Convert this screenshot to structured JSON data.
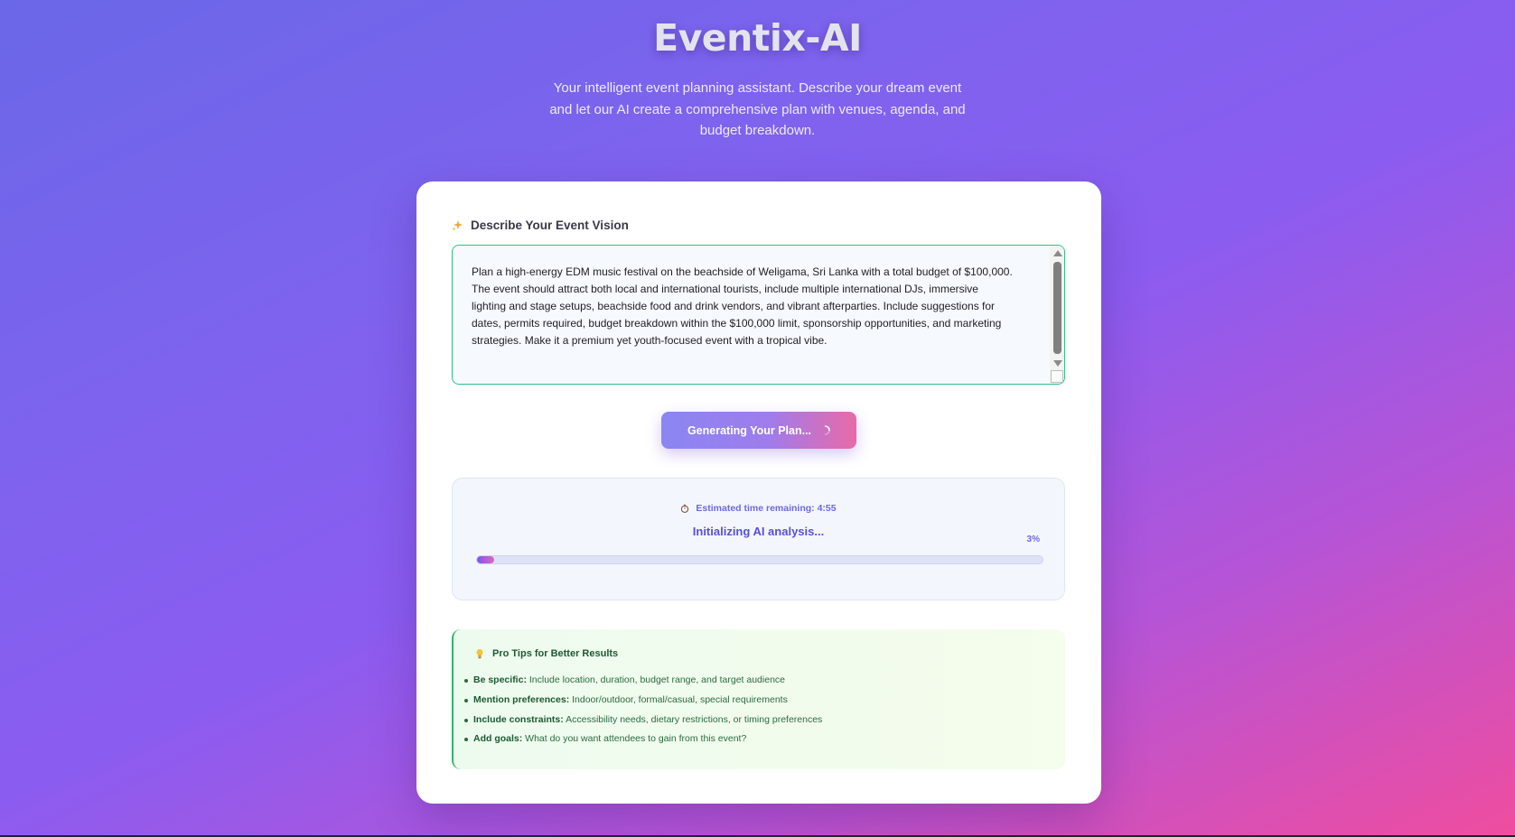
{
  "header": {
    "title": "Eventix-AI",
    "subtitle": "Your intelligent event planning assistant. Describe your dream event and let our AI create a comprehensive plan with venues, agenda, and budget breakdown."
  },
  "form": {
    "section_label": "Describe Your Event Vision",
    "section_icon": "sparkle-icon",
    "prompt_value": "Plan a high-energy EDM music festival on the beachside of Weligama, Sri Lanka with a total budget of $100,000. The event should attract both local and international tourists, include multiple international DJs, immersive lighting and stage setups, beachside food and drink vendors, and vibrant afterparties. Include suggestions for dates, permits required, budget breakdown within the $100,000 limit, sponsorship opportunities, and marketing strategies. Make it a premium yet youth-focused event with a tropical vibe.",
    "generate_button_label": "Generating Your Plan...",
    "button_icon": "spinner-icon"
  },
  "progress": {
    "time_icon": "stopwatch-icon",
    "time_remaining": "Estimated time remaining: 4:55",
    "status": "Initializing AI analysis...",
    "percent_label": "3%",
    "percent_value": 3
  },
  "tips": {
    "icon": "lightbulb-icon",
    "heading": "Pro Tips for Better Results",
    "items": [
      {
        "key": "Be specific:",
        "text": " Include location, duration, budget range, and target audience"
      },
      {
        "key": "Mention preferences:",
        "text": " Indoor/outdoor, formal/casual, special requirements"
      },
      {
        "key": "Include constraints:",
        "text": " Accessibility needs, dietary restrictions, or timing preferences"
      },
      {
        "key": "Add goals:",
        "text": " What do you want attendees to gain from this event?"
      }
    ]
  },
  "colors": {
    "accent": "#6d67e6",
    "focus_border": "#2ec27e",
    "gradient_start": "#6a67e8",
    "gradient_end": "#ef4d9f"
  }
}
